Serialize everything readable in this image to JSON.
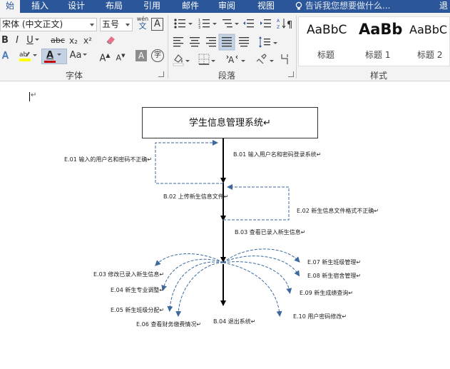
{
  "ribbon": {
    "tabs": [
      "始",
      "插入",
      "设计",
      "布局",
      "引用",
      "邮件",
      "审阅",
      "视图"
    ],
    "tell_me": "告诉我您想要做什么...",
    "edge_char": "退",
    "font": {
      "name": "宋体 (中文正文)",
      "size": "五号",
      "pinyin_top": "wén",
      "pinyin_bottom": "文",
      "border_char": "A",
      "bold": "B",
      "italic": "I",
      "underline": "U",
      "strike": "abc",
      "sub": "x₂",
      "sup": "x²",
      "color_a": "A",
      "case": "Aa",
      "grow": "A",
      "shrink": "A",
      "shade_a": "A",
      "circle_char": "字",
      "label": "字体"
    },
    "paragraph": {
      "label": "段落"
    },
    "styles": {
      "label": "样式",
      "items": [
        {
          "preview": "AaBbC",
          "name": "标题"
        },
        {
          "preview": "AaBb",
          "name": "标题 1"
        },
        {
          "preview": "AaBbC",
          "name": "标题 2"
        }
      ]
    }
  },
  "document": {
    "paragraph_mark": "↵",
    "title": "学生信息管理系统↵",
    "labels": {
      "b01": "B.01  输入用户名和密码登录系统↵",
      "e01": "E.01 输入的用户名和密码不正确↵",
      "b02": "B.02  上传新生信息文件↵",
      "e02": "E.02 新生信息文件格式不正确↵",
      "b03": "B.03  查看已录入新生信息↵",
      "e03": "E.03 修改已录入新生信息↵",
      "e04": "E.04  新生专业调整↵",
      "e05": "E.05  新生班级分配↵",
      "e06": "E.06  查看财务缴费情况↵",
      "b04": "B.04 退出系统↵",
      "e07": "E.07 新生班级管理↵",
      "e08": "E.08 新生宿舍管理↵",
      "e09": "E.09 新生成绩查询↵",
      "e10": "E.10  用户密码修改↵"
    }
  },
  "colors": {
    "ribbon_tab_bg": "#2b579a",
    "dashed_arrow": "#3d6a9e",
    "font_color_bar": "#c00000",
    "highlight_bar": "#ffff00"
  }
}
